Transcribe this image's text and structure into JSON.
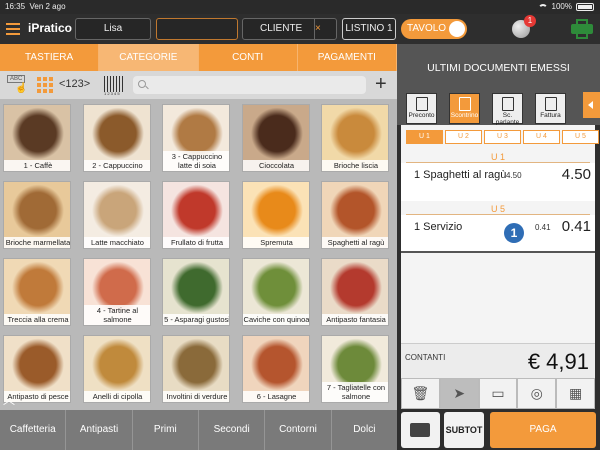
{
  "status": {
    "time": "16:35",
    "date": "Ven 2 ago",
    "battery": "100%"
  },
  "header": {
    "app": "iPratico",
    "operator": "Lisa",
    "empty_field": "",
    "cliente": "CLIENTE",
    "clear": "×",
    "listino": "LISTINO 1",
    "tavolo": "TAVOLO",
    "notifications": "1"
  },
  "tabs": [
    "TASTIERA",
    "CATEGORIE",
    "CONTI",
    "PAGAMENTI"
  ],
  "tools": {
    "numpad": "<123>",
    "barcode_digits": "1 2 3 4 5"
  },
  "products": [
    "1 - Caffè",
    "2 - Cappuccino",
    "3 - Cappuccino latte di soia",
    "Cioccolata",
    "Brioche liscia",
    "Brioche marmellata",
    "Latte macchiato",
    "Frullato di frutta",
    "Spremuta",
    "Spaghetti al ragù",
    "Treccia alla crema",
    "4 - Tartine al salmone",
    "5 - Asparagi gustosi",
    "Caviche con quinoa",
    "Antipasto fantasia",
    "Antipasto di pesce",
    "Anelli di cipolla",
    "Involtini di verdure",
    "6 - Lasagne",
    "7 - Tagliatelle con salmone"
  ],
  "categories": [
    "Caffetteria",
    "Antipasti",
    "Primi",
    "Secondi",
    "Contorni",
    "Dolci"
  ],
  "right": {
    "title": "ULTIMI DOCUMENTI EMESSI",
    "doc_tabs": [
      "Preconto",
      "Scontrino",
      "Sc. parlante",
      "Fattura"
    ],
    "users": [
      "U 1",
      "U 2",
      "U 3",
      "U 4",
      "U 5"
    ],
    "groups": [
      {
        "user": "U 1",
        "qty_name": "1 Spaghetti al ragù",
        "unit": "4.50",
        "total": "4.50"
      },
      {
        "user": "U 5",
        "qty_name": "1 Servizio",
        "unit": "0.41",
        "total": "0.41",
        "bubble": "1"
      }
    ],
    "payment_label": "CONTANTI",
    "amount": "€ 4,91",
    "subtot": "SUBTOT",
    "paga": "PAGA"
  },
  "colors": {
    "accent": "#f39a3b",
    "bubble": "#2f6db5",
    "dark": "#2e2e2e"
  },
  "icons": [
    "trash-icon",
    "paper-plane-icon",
    "tray-icon",
    "coin-icon",
    "qr-code-icon",
    "wallet-icon",
    "printer-icon",
    "globe-icon"
  ]
}
